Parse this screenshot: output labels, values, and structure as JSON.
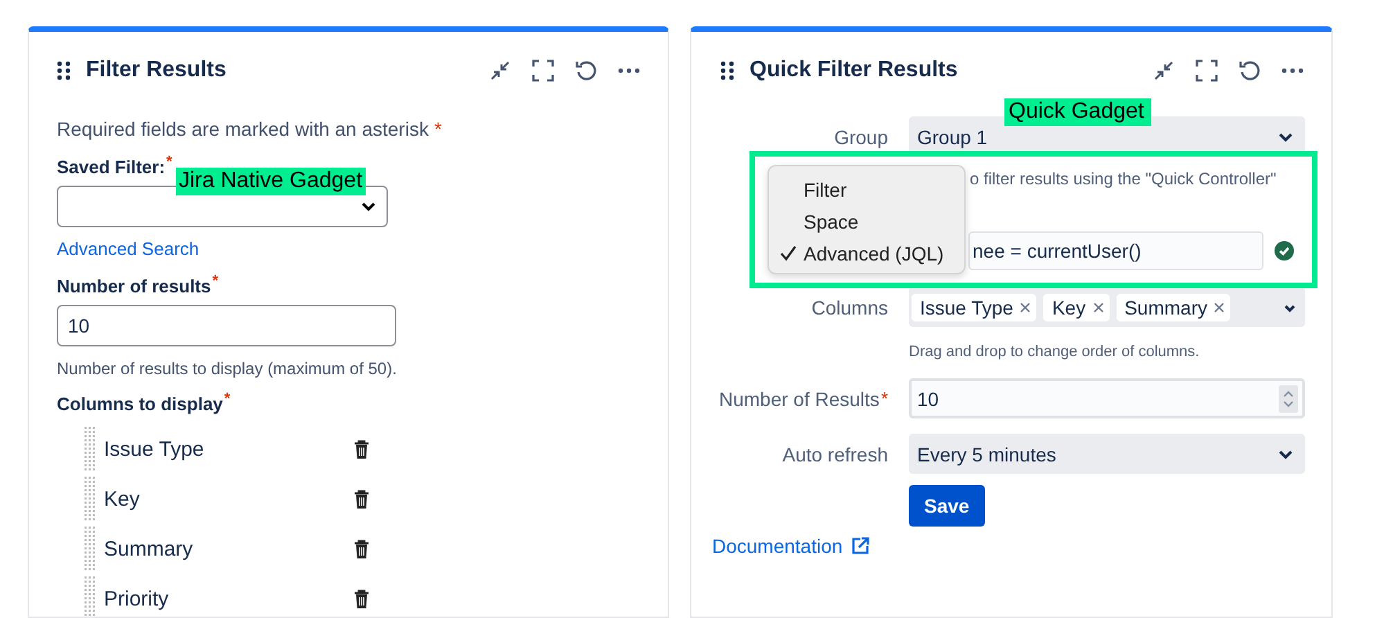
{
  "filter_results": {
    "title": "Filter Results",
    "intro": {
      "text": "Required fields are marked with an asterisk",
      "required_mark": "*"
    },
    "saved_filter": {
      "label": "Saved Filter:",
      "required_mark": "*"
    },
    "advanced_search": "Advanced Search",
    "number_of_results": {
      "label": "Number of results",
      "required_mark": "*",
      "value": "10",
      "hint": "Number of results to display (maximum of 50)."
    },
    "columns": {
      "label": "Columns to display",
      "required_mark": "*",
      "items": [
        "Issue Type",
        "Key",
        "Summary",
        "Priority"
      ]
    }
  },
  "quick_filter_results": {
    "title": "Quick Filter Results",
    "group": {
      "label": "Group",
      "value": "Group 1"
    },
    "filter_hint": "o filter results using the \"Quick Controller\"",
    "query": {
      "value": "nee = currentUser()",
      "valid": true
    },
    "filter_type_menu": [
      {
        "label": "Filter",
        "selected": false
      },
      {
        "label": "Space",
        "selected": false
      },
      {
        "label": "Advanced (JQL)",
        "selected": true
      }
    ],
    "columns": {
      "label": "Columns",
      "tags": [
        "Issue Type",
        "Key",
        "Summary"
      ],
      "hint": "Drag and drop to change order of columns."
    },
    "number_of_results": {
      "label": "Number of Results",
      "required_mark": "*",
      "value": "10"
    },
    "auto_refresh": {
      "label": "Auto refresh",
      "value": "Every 5 minutes"
    },
    "save": "Save",
    "documentation": "Documentation"
  },
  "annotations": [
    {
      "text": "Jira Native Gadget"
    },
    {
      "text": "Quick Gadget"
    }
  ]
}
